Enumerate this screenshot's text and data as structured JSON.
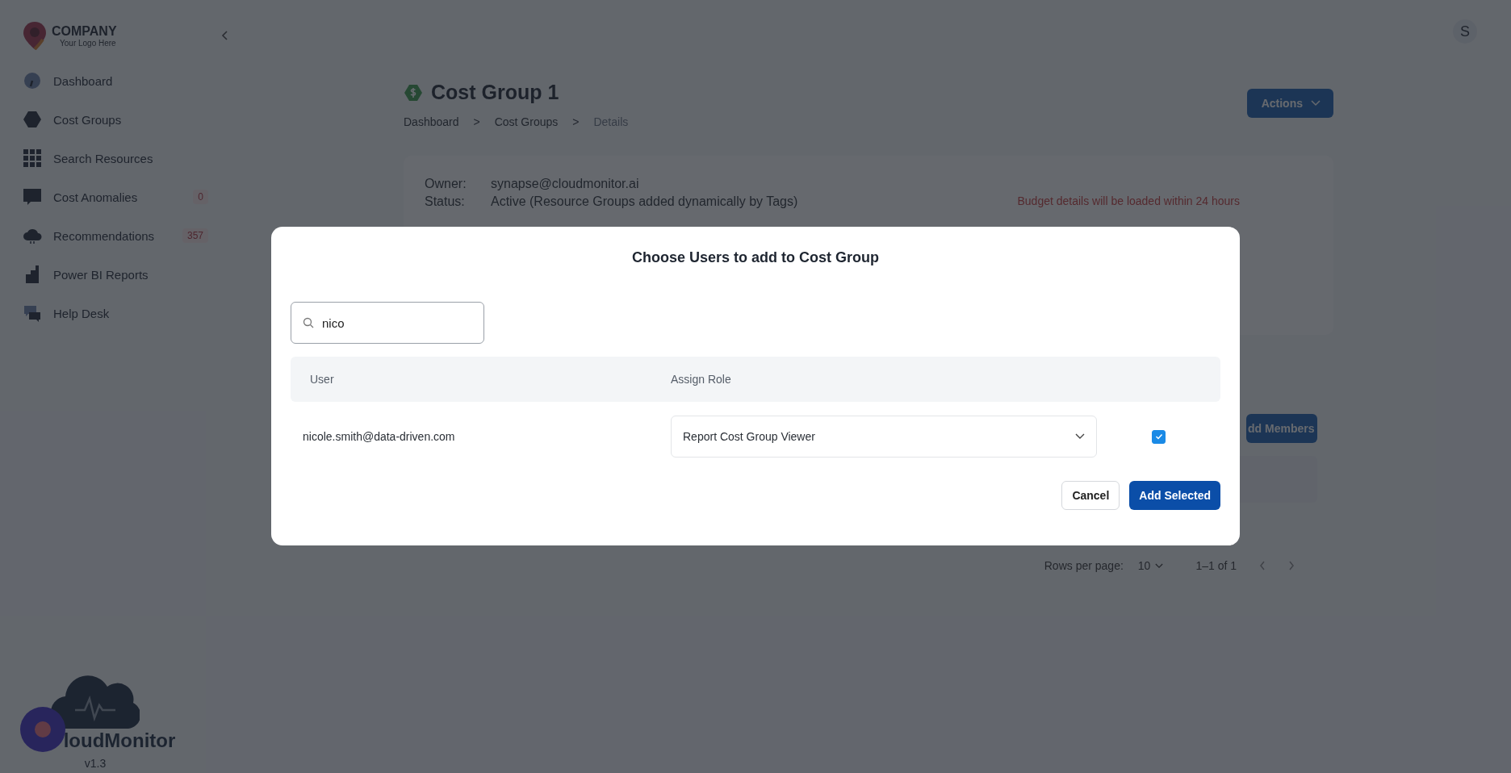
{
  "sidebar": {
    "logo": {
      "name": "COMPANY",
      "tagline": "Your Logo Here"
    },
    "items": [
      {
        "label": "Dashboard"
      },
      {
        "label": "Cost Groups"
      },
      {
        "label": "Search Resources"
      },
      {
        "label": "Cost Anomalies",
        "badge": "0"
      },
      {
        "label": "Recommendations",
        "badge": "357"
      },
      {
        "label": "Power BI Reports"
      },
      {
        "label": "Help Desk"
      }
    ],
    "footer": {
      "brand": "loudMonitor",
      "version": "v1.3"
    }
  },
  "avatar": {
    "initial": "S"
  },
  "page": {
    "title": "Cost Group 1",
    "breadcrumbs": [
      {
        "label": "Dashboard",
        "current": false
      },
      {
        "label": "Cost Groups",
        "current": false
      },
      {
        "label": "Details",
        "current": true
      }
    ],
    "breadcrumb_separator": ">",
    "actions_button": "Actions",
    "details": [
      {
        "label": "Owner:",
        "value": "synapse@cloudmonitor.ai"
      },
      {
        "label": "Status:",
        "value": "Active (Resource Groups added dynamically by Tags)"
      }
    ],
    "budget_note": "Budget details will be loaded within 24 hours",
    "members_button": "dd Members",
    "pagination": {
      "rows_label": "Rows per page:",
      "rows_value": "10",
      "range": "1–1 of 1"
    }
  },
  "modal": {
    "title": "Choose Users to add to Cost Group",
    "search": {
      "value": "nico"
    },
    "columns": [
      "User",
      "Assign Role"
    ],
    "rows": [
      {
        "user": "nicole.smith@data-driven.com",
        "role": "Report Cost Group Viewer",
        "checked": true
      }
    ],
    "buttons": {
      "cancel": "Cancel",
      "confirm": "Add Selected"
    }
  }
}
